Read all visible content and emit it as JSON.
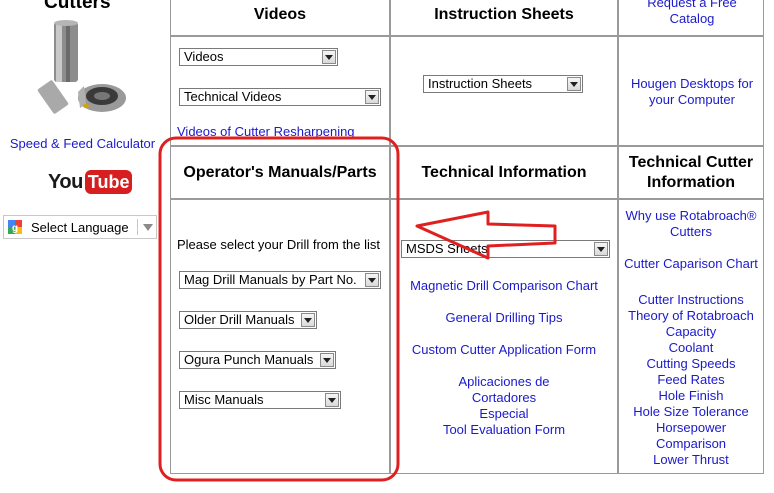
{
  "sidebar": {
    "title": "Cutters",
    "speed_feed_link": "Speed & Feed Calculator",
    "youtube_you": "You",
    "youtube_tube": "Tube",
    "translate_label": "Select Language"
  },
  "grid": {
    "videos": {
      "header": "Videos",
      "select1": "Videos",
      "select2": "Technical Videos",
      "link": "Videos of Cutter Resharpening"
    },
    "instruction": {
      "header": "Instruction Sheets",
      "select": "Instruction Sheets"
    },
    "catalog": {
      "request_link": "Request a Free Catalog",
      "desktops_link": "Hougen Desktops for your Computer"
    },
    "manuals": {
      "header": "Operator's Manuals/Parts",
      "prompt": "Please select your Drill from the list",
      "select1": "Mag Drill Manuals by Part No.",
      "select2": "Older Drill Manuals",
      "select3": "Ogura Punch Manuals",
      "select4": "Misc Manuals"
    },
    "technical": {
      "header": "Technical Information",
      "msds_select": "MSDS Sheets",
      "links": [
        "Magnetic Drill Comparison Chart",
        "General Drilling Tips",
        "Custom Cutter Application Form",
        "Aplicaciones de Cortadores Especial",
        "Tool Evaluation Form"
      ]
    },
    "cutter_info": {
      "header": "Technical Cutter Information",
      "links": [
        "Why use Rotabroach® Cutters",
        "Cutter Caparison Chart",
        "Cutter Instructions",
        "Theory of Rotabroach Capacity",
        "Coolant",
        "Cutting Speeds",
        "Feed Rates",
        "Hole Finish",
        "Hole Size Tolerance",
        "Horsepower Comparison",
        "Lower Thrust"
      ]
    }
  },
  "colors": {
    "link": "#1a1acc",
    "highlight": "#e02020",
    "youtube_red": "#d81f1f"
  }
}
